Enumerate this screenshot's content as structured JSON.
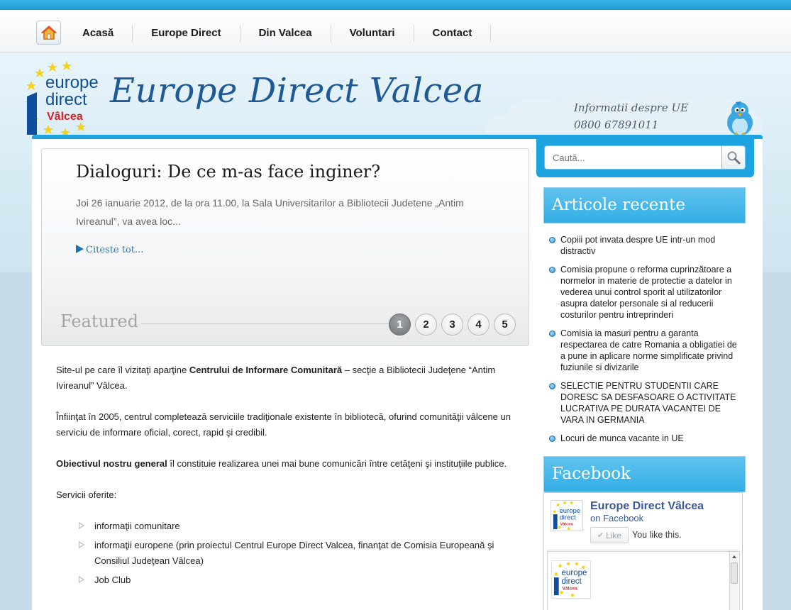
{
  "nav": {
    "home_icon": "home-icon",
    "items": [
      "Acasă",
      "Europe Direct",
      "Din Valcea",
      "Voluntari",
      "Contact"
    ]
  },
  "header": {
    "logo_lines": [
      "europe",
      "direct",
      "Vâlcea"
    ],
    "site_title": "Europe Direct Valcea",
    "contact_line1": "Informatii despre UE",
    "contact_line2": "0800 67891011"
  },
  "featured": {
    "title": "Dialoguri: De ce m-as face inginer?",
    "excerpt": "Joi 26 ianuarie 2012, de la ora 11.00, la Sala Universitarilor a Bibliotecii Judetene „Antim Ivireanul”, va avea loc...",
    "read_more": "Citeste tot...",
    "label": "Featured",
    "pages": [
      "1",
      "2",
      "3",
      "4",
      "5"
    ],
    "active_page": 1
  },
  "content": {
    "p1_prefix": "Site-ul pe care îl vizitaţi aparţine ",
    "p1_bold": "Centrului de Informare Comunitară",
    "p1_suffix": " – secţie a Bibliotecii Judeţene “Antim Ivireanul” Vâlcea.",
    "p2": "Înfiinţat în 2005, centrul completează serviciile tradiţionale existente în bibliotecă, ofurind comunităţii vâlcene un serviciu de informare oficial, corect, rapid şi credibil.",
    "p3_bold": "Obiectivul nostru general",
    "p3_suffix": " îl constituie realizarea unei mai bune comunicări între cetăţeni şi instituţiile publice.",
    "services_title": "Servicii oferite:",
    "services": [
      "informaţii comunitare",
      "informaţii europene (prin proiectul Centrul Europe Direct Valcea, finanţat de Comisia Europeană şi Consiliul Judeţean Vâlcea)",
      "Job Club"
    ]
  },
  "sidebar": {
    "search_placeholder": "Caută...",
    "search_icon": "magnifier-icon",
    "recent_title": "Articole recente",
    "recent": [
      "Copiii pot invata despre UE intr-un mod distractiv",
      "Comisia propune o reforma cuprinzătoare a normelor in materie de protectie a datelor in vederea unui control sporit al utilizatorilor asupra datelor personale si al reducerii costurilor pentru intreprinderi",
      "Comisia ia masuri pentru a garanta respectarea de catre Romania a obligatiei de a pune in aplicare norme simplificate privind fuziunile si divizarile",
      "SELECTIE PENTRU STUDENTII CARE DORESC SA DESFASOARE O ACTIVITATE LUCRATIVA PE DURATA VACANTEI DE VARA IN GERMANIA",
      "Locuri de munca vacante in UE"
    ],
    "facebook_title": "Facebook",
    "fb_page_name": "Europe Direct Vâlcea",
    "fb_on": "on Facebook",
    "fb_like": "Like",
    "fb_you_like": "You like this."
  },
  "colors": {
    "accent_blue": "#1da3e0",
    "title_blue": "#1d5a96",
    "facebook_blue": "#3b5998"
  }
}
